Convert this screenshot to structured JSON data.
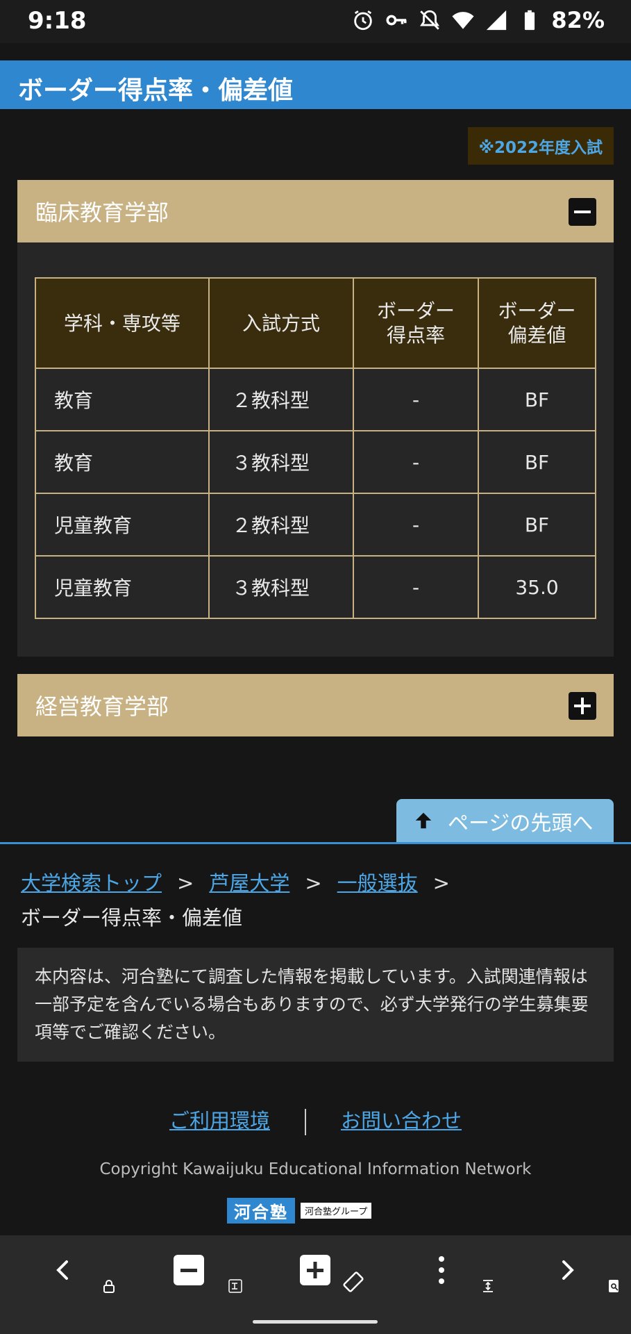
{
  "status_bar": {
    "time": "9:18",
    "battery": "82%",
    "icons": [
      "alarm-icon",
      "vpn-key-icon",
      "notifications-off-icon",
      "wifi-icon",
      "signal-icon",
      "battery-icon"
    ]
  },
  "header": {
    "title": "ボーダー得点率・偏差値"
  },
  "year_badge": "※2022年度入試",
  "accordions": [
    {
      "title": "臨床教育学部",
      "state": "expanded",
      "table": {
        "headers": [
          "学科・専攻等",
          "入試方式",
          "ボーダー\n得点率",
          "ボーダー\n偏差値"
        ],
        "rows": [
          [
            "教育",
            "２教科型",
            "-",
            "BF"
          ],
          [
            "教育",
            "３教科型",
            "-",
            "BF"
          ],
          [
            "児童教育",
            "２教科型",
            "-",
            "BF"
          ],
          [
            "児童教育",
            "３教科型",
            "-",
            "35.0"
          ]
        ]
      }
    },
    {
      "title": "経営教育学部",
      "state": "collapsed"
    }
  ],
  "page_top": {
    "label": "ページの先頭へ"
  },
  "breadcrumb": {
    "links": [
      "大学検索トップ",
      "芦屋大学",
      "一般選抜"
    ],
    "separator": ">",
    "current": "ボーダー得点率・偏差値"
  },
  "notice": "本内容は、河合塾にて調査した情報を掲載しています。入試関連情報は一部予定を含んでいる場合もありますので、必ず大学発行の学生募集要項等でご確認ください。",
  "footer": {
    "links": [
      "ご利用環境",
      "お問い合わせ"
    ],
    "copyright": "Copyright Kawaijuku Educational Information Network",
    "logo_main": "河合塾",
    "logo_sub": "河合塾グループ"
  },
  "colors": {
    "header_blue": "#2f87cf",
    "accordion_tan": "#c8b183",
    "link_blue": "#4da7e6",
    "table_header_bg": "#3a2d0e"
  }
}
